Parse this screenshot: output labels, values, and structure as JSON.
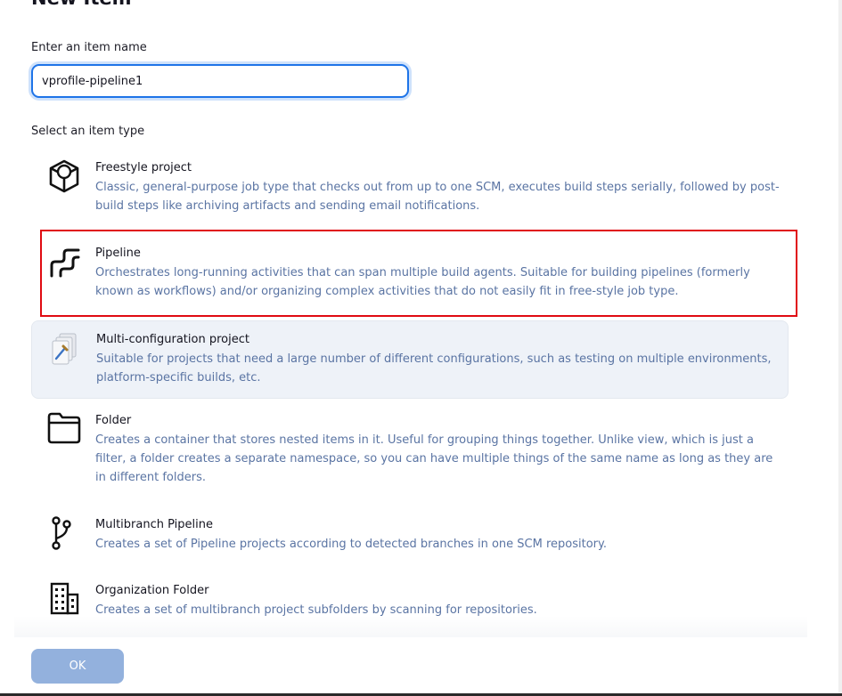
{
  "page": {
    "title": "New Item",
    "name_label": "Enter an item name",
    "name_value": "vprofile-pipeline1",
    "type_label": "Select an item type"
  },
  "items": [
    {
      "title": "Freestyle project",
      "description": "Classic, general-purpose job type that checks out from up to one SCM, executes build steps serially, followed by post-build steps like archiving artifacts and sending email notifications.",
      "icon": "cube-icon"
    },
    {
      "title": "Pipeline",
      "description": "Orchestrates long-running activities that can span multiple build agents. Suitable for building pipelines (formerly known as workflows) and/or organizing complex activities that do not easily fit in free-style job type.",
      "icon": "pipeline-icon"
    },
    {
      "title": "Multi-configuration project",
      "description": "Suitable for projects that need a large number of different configurations, such as testing on multiple environments, platform-specific builds, etc.",
      "icon": "multi-config-icon"
    },
    {
      "title": "Folder",
      "description": "Creates a container that stores nested items in it. Useful for grouping things together. Unlike view, which is just a filter, a folder creates a separate namespace, so you can have multiple things of the same name as long as they are in different folders.",
      "icon": "folder-icon"
    },
    {
      "title": "Multibranch Pipeline",
      "description": "Creates a set of Pipeline projects according to detected branches in one SCM repository.",
      "icon": "branch-icon"
    },
    {
      "title": "Organization Folder",
      "description": "Creates a set of multibranch project subfolders by scanning for repositories.",
      "icon": "building-icon"
    }
  ],
  "actions": {
    "ok_label": "OK"
  },
  "colors": {
    "highlight": "#e00b12",
    "input_focus": "#1e74e8",
    "description_text": "#5a74a3",
    "ok_button": "#93b1dd"
  }
}
